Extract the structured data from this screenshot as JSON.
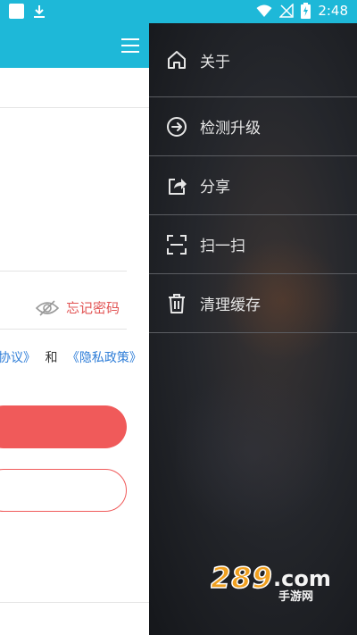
{
  "status_bar": {
    "time": "2:48"
  },
  "form": {
    "forgot_password": "忘记密码",
    "agreement": {
      "part1": "协议》",
      "and": "和",
      "privacy_link": "《隐私政策》"
    }
  },
  "drawer": {
    "items": [
      {
        "label": "关于",
        "icon": "home-icon"
      },
      {
        "label": "检测升级",
        "icon": "arrow-right-circle-icon"
      },
      {
        "label": "分享",
        "icon": "share-icon"
      },
      {
        "label": "扫一扫",
        "icon": "scan-icon"
      },
      {
        "label": "清理缓存",
        "icon": "trash-icon"
      }
    ]
  },
  "watermark": {
    "brand": "289",
    "tld": ".com",
    "sub": "手游网"
  },
  "colors": {
    "primary": "#1eb8d8",
    "accent": "#f05a5a",
    "link": "#2f7ed8",
    "drawer_bg": "#1d1f24"
  }
}
